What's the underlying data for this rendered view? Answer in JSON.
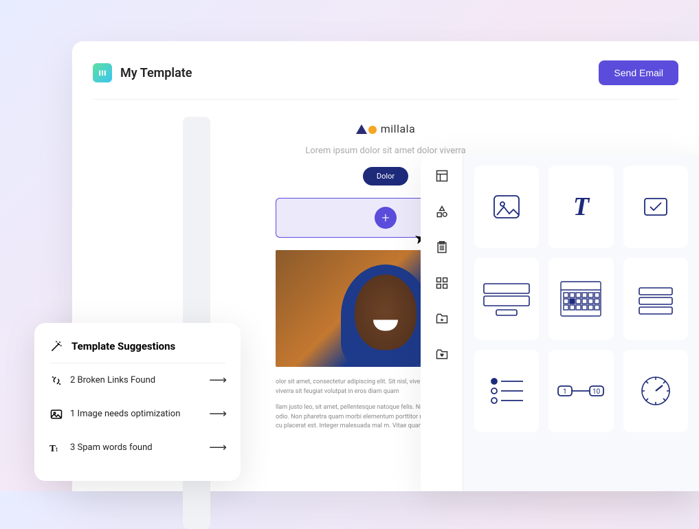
{
  "header": {
    "title": "My Template",
    "send_button": "Send Email"
  },
  "template": {
    "brand_name": "millala",
    "tagline": "Lorem ipsum dolor sit amet dolor viverra",
    "cta_label": "Dolor",
    "body_p1": "olor sit amet, consectetur adipiscing elit. Sit nisl, viverra potenti mauris. Nulla viverra sit feugiat volutpat in eros diam quam",
    "body_p2": "llam justo leo, sit amet, pellentesque natoque felis. Nisi, enim purus ale nunc odio. Non pharetra quam morbi elementum porttitor re turpis. Fusce cum nulla cu placerat est. Integer malesuada mal m. Vitae quam senectus nibh cursus."
  },
  "suggestions": {
    "title": "Template Suggestions",
    "items": [
      {
        "text": "2 Broken Links Found",
        "icon": "broken-link"
      },
      {
        "text": "1 Image needs optimization",
        "icon": "image"
      },
      {
        "text": "3 Spam words found",
        "icon": "text-case"
      }
    ]
  },
  "toolrail": {
    "items": [
      "layout",
      "shapes",
      "clipboard",
      "grid",
      "folder-star",
      "folder-heart"
    ]
  },
  "elements": {
    "items": [
      "image",
      "text",
      "checkbox",
      "form",
      "calendar",
      "rows",
      "list",
      "range",
      "gauge"
    ]
  }
}
